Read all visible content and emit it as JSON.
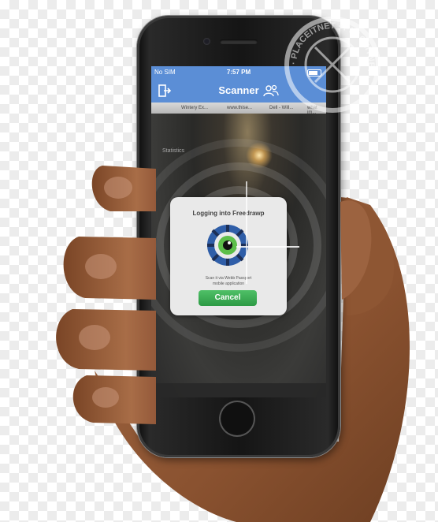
{
  "statusbar": {
    "carrier": "No SIM",
    "time": "7:57 PM"
  },
  "navbar": {
    "title": "Scanner",
    "left_icon": "logout-icon",
    "right_icon": "users-icon"
  },
  "camera": {
    "browser_tabs": [
      "Wintery Ex...",
      "www.thise...",
      "Dell - Will...",
      "what im..."
    ],
    "side_label": "Statistics"
  },
  "dialog": {
    "title": "Logging into Freedrawp",
    "description_line1": "Scan it via Webb Passport",
    "description_line2": "mobile application",
    "cancel_label": "Cancel"
  },
  "watermark": {
    "text": "· PLACEITNET · PLACEITNET ·"
  },
  "colors": {
    "nav_bar": "#5b8ed6",
    "cancel_button": "#2d9a45",
    "dialog_bg": "#e9e9e9"
  }
}
